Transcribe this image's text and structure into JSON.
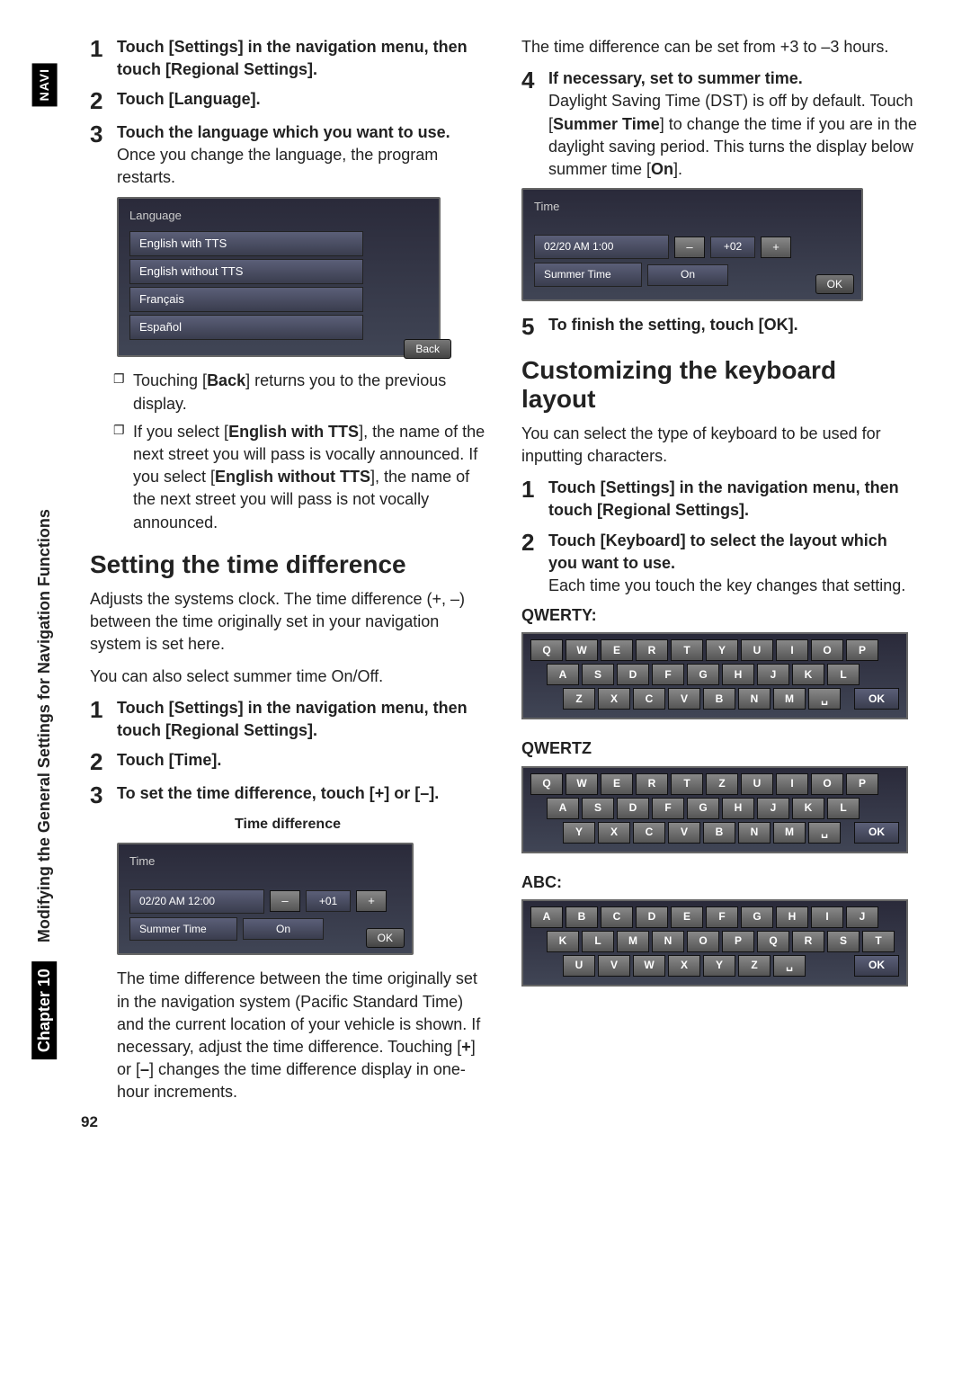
{
  "side": {
    "navi": "NAVI",
    "chapter": "Chapter 10",
    "title": "Modifying the General Settings for Navigation Functions"
  },
  "pageNumber": "92",
  "left": {
    "steps1": [
      {
        "n": "1",
        "head": "Touch [Settings] in the navigation menu, then touch [Regional Settings]."
      },
      {
        "n": "2",
        "head": "Touch [Language]."
      },
      {
        "n": "3",
        "head": "Touch the language which you want to use.",
        "desc": "Once you change the language, the program restarts."
      }
    ],
    "langUI": {
      "title": "Language",
      "items": [
        "English with TTS",
        "English without TTS",
        "Français",
        "Español"
      ],
      "back": "Back"
    },
    "bullets": [
      {
        "pre": "Touching [",
        "bold1": "Back",
        "post": "] returns you to the previous display."
      },
      {
        "pre": "If you select [",
        "bold1": "English with TTS",
        "mid": "], the name of the next street you will pass is vocally announced. If you select [",
        "bold2": "English without TTS",
        "post": "], the name of the next street you will pass is not vocally announced."
      }
    ],
    "h2a": "Setting the time difference",
    "paraA": "Adjusts the systems clock. The time difference (+, –) between the time originally set in your navigation system is set here.",
    "paraA2": "You can also select summer time On/Off.",
    "steps2": [
      {
        "n": "1",
        "head": "Touch [Settings] in the navigation menu, then touch [Regional Settings]."
      },
      {
        "n": "2",
        "head": "Touch [Time]."
      },
      {
        "n": "3",
        "head": "To set the time difference, touch [+] or [–]."
      }
    ],
    "timeCaption": "Time difference",
    "timeUI": {
      "title": "Time",
      "clock": "02/20 AM 12:00",
      "minus": "–",
      "val": "+01",
      "plus": "+",
      "summerLabel": "Summer Time",
      "summerVal": "On",
      "ok": "OK"
    },
    "paraB": "The time difference between the time originally set in the navigation system (Pacific Standard Time) and the current location of your vehicle is shown. If necessary, adjust the time difference. Touching [",
    "paraB_b1": "+",
    "paraB_mid": "] or [",
    "paraB_b2": "–",
    "paraB_post": "] changes the time difference display in one-hour increments."
  },
  "right": {
    "paraTop": "The time difference can be set from +3 to –3 hours.",
    "steps3": [
      {
        "n": "4",
        "head": "If necessary, set to summer time.",
        "descPre": "Daylight Saving Time (DST) is off by default. Touch [",
        "descB1": "Summer Time",
        "descMid": "] to change the time if you are in the daylight saving period. This turns the display below summer time [",
        "descB2": "On",
        "descPost": "]."
      }
    ],
    "timeUI2": {
      "title": "Time",
      "clock": "02/20 AM 1:00",
      "minus": "–",
      "val": "+02",
      "plus": "+",
      "summerLabel": "Summer Time",
      "summerVal": "On",
      "ok": "OK"
    },
    "steps4": [
      {
        "n": "5",
        "head": "To finish the setting, touch [OK]."
      }
    ],
    "h2b": "Customizing the keyboard layout",
    "paraC": "You can select the type of keyboard to be used for inputting characters.",
    "steps5": [
      {
        "n": "1",
        "head": "Touch [Settings] in the navigation menu, then touch [Regional Settings]."
      },
      {
        "n": "2",
        "head": "Touch [Keyboard] to select the layout which you want to use.",
        "desc": "Each time you touch the key changes that setting."
      }
    ],
    "kbd": {
      "qwerty": {
        "label": "QWERTY:",
        "rows": [
          [
            "Q",
            "W",
            "E",
            "R",
            "T",
            "Y",
            "U",
            "I",
            "O",
            "P"
          ],
          [
            "A",
            "S",
            "D",
            "F",
            "G",
            "H",
            "J",
            "K",
            "L"
          ],
          [
            "Z",
            "X",
            "C",
            "V",
            "B",
            "N",
            "M",
            "␣"
          ]
        ],
        "ok": "OK"
      },
      "qwertz": {
        "label": "QWERTZ",
        "rows": [
          [
            "Q",
            "W",
            "E",
            "R",
            "T",
            "Z",
            "U",
            "I",
            "O",
            "P"
          ],
          [
            "A",
            "S",
            "D",
            "F",
            "G",
            "H",
            "J",
            "K",
            "L"
          ],
          [
            "Y",
            "X",
            "C",
            "V",
            "B",
            "N",
            "M",
            "␣"
          ]
        ],
        "ok": "OK"
      },
      "abc": {
        "label": "ABC:",
        "rows": [
          [
            "A",
            "B",
            "C",
            "D",
            "E",
            "F",
            "G",
            "H",
            "I",
            "J"
          ],
          [
            "K",
            "L",
            "M",
            "N",
            "O",
            "P",
            "Q",
            "R",
            "S",
            "T"
          ],
          [
            "U",
            "V",
            "W",
            "X",
            "Y",
            "Z",
            "␣"
          ]
        ],
        "ok": "OK"
      }
    }
  }
}
